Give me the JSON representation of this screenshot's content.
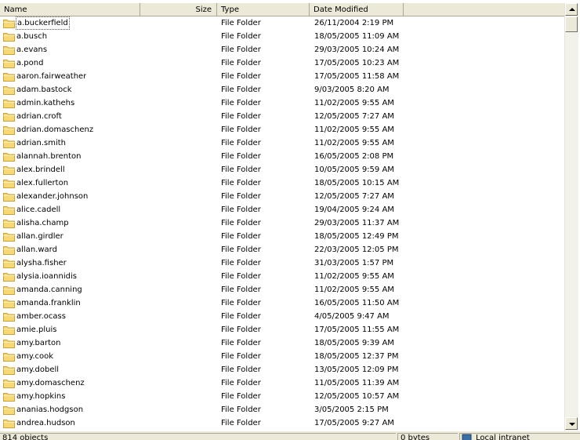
{
  "columns": {
    "name": "Name",
    "size": "Size",
    "type": "Type",
    "date": "Date Modified"
  },
  "rows": [
    {
      "name": "a.buckerfield",
      "type": "File Folder",
      "date": "26/11/2004 2:19 PM"
    },
    {
      "name": "a.busch",
      "type": "File Folder",
      "date": "18/05/2005 11:09 AM"
    },
    {
      "name": "a.evans",
      "type": "File Folder",
      "date": "29/03/2005 10:24 AM"
    },
    {
      "name": "a.pond",
      "type": "File Folder",
      "date": "17/05/2005 10:23 AM"
    },
    {
      "name": "aaron.fairweather",
      "type": "File Folder",
      "date": "17/05/2005 11:58 AM"
    },
    {
      "name": "adam.bastock",
      "type": "File Folder",
      "date": "9/03/2005 8:20 AM"
    },
    {
      "name": "admin.kathehs",
      "type": "File Folder",
      "date": "11/02/2005 9:55 AM"
    },
    {
      "name": "adrian.croft",
      "type": "File Folder",
      "date": "12/05/2005 7:27 AM"
    },
    {
      "name": "adrian.domaschenz",
      "type": "File Folder",
      "date": "11/02/2005 9:55 AM"
    },
    {
      "name": "adrian.smith",
      "type": "File Folder",
      "date": "11/02/2005 9:55 AM"
    },
    {
      "name": "alannah.brenton",
      "type": "File Folder",
      "date": "16/05/2005 2:08 PM"
    },
    {
      "name": "alex.brindell",
      "type": "File Folder",
      "date": "10/05/2005 9:59 AM"
    },
    {
      "name": "alex.fullerton",
      "type": "File Folder",
      "date": "18/05/2005 10:15 AM"
    },
    {
      "name": "alexander.johnson",
      "type": "File Folder",
      "date": "12/05/2005 7:27 AM"
    },
    {
      "name": "alice.cadell",
      "type": "File Folder",
      "date": "19/04/2005 9:24 AM"
    },
    {
      "name": "alisha.champ",
      "type": "File Folder",
      "date": "29/03/2005 11:37 AM"
    },
    {
      "name": "allan.girdler",
      "type": "File Folder",
      "date": "18/05/2005 12:49 PM"
    },
    {
      "name": "allan.ward",
      "type": "File Folder",
      "date": "22/03/2005 12:05 PM"
    },
    {
      "name": "alysha.fisher",
      "type": "File Folder",
      "date": "31/03/2005 1:57 PM"
    },
    {
      "name": "alysia.ioannidis",
      "type": "File Folder",
      "date": "11/02/2005 9:55 AM"
    },
    {
      "name": "amanda.canning",
      "type": "File Folder",
      "date": "11/02/2005 9:55 AM"
    },
    {
      "name": "amanda.franklin",
      "type": "File Folder",
      "date": "16/05/2005 11:50 AM"
    },
    {
      "name": "amber.ocass",
      "type": "File Folder",
      "date": "4/05/2005 9:47 AM"
    },
    {
      "name": "amie.pluis",
      "type": "File Folder",
      "date": "17/05/2005 11:55 AM"
    },
    {
      "name": "amy.barton",
      "type": "File Folder",
      "date": "18/05/2005 9:39 AM"
    },
    {
      "name": "amy.cook",
      "type": "File Folder",
      "date": "18/05/2005 12:37 PM"
    },
    {
      "name": "amy.dobell",
      "type": "File Folder",
      "date": "13/05/2005 12:09 PM"
    },
    {
      "name": "amy.domaschenz",
      "type": "File Folder",
      "date": "11/05/2005 11:39 AM"
    },
    {
      "name": "amy.hopkins",
      "type": "File Folder",
      "date": "12/05/2005 10:57 AM"
    },
    {
      "name": "ananias.hodgson",
      "type": "File Folder",
      "date": "3/05/2005 2:15 PM"
    },
    {
      "name": "andrea.hudson",
      "type": "File Folder",
      "date": "17/05/2005 9:27 AM"
    }
  ],
  "status": {
    "objects": "814 objects",
    "size": "0 bytes",
    "zone": "Local intranet"
  },
  "colors": {
    "folder_fill": "#f8d775",
    "folder_edge": "#c8a23c"
  }
}
